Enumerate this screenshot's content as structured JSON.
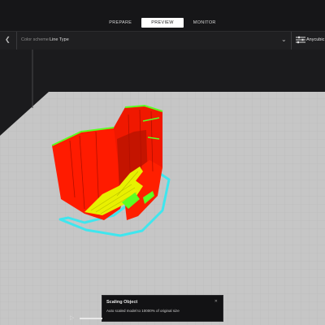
{
  "header": {
    "tabs": [
      {
        "label": "PREPARE",
        "active": false
      },
      {
        "label": "PREVIEW",
        "active": true
      },
      {
        "label": "MONITOR",
        "active": false
      }
    ]
  },
  "stage_menu": {
    "color_scheme_label": "Color scheme",
    "color_scheme_value": "Line Type",
    "printer_name": "Anycubic"
  },
  "message": {
    "title": "Scaling Object",
    "body": "Auto scaled model to 10000% of original size",
    "close_icon": "x-icon"
  },
  "colors": {
    "header_bg": "#161618",
    "active_tab_bg": "#ffffff",
    "build_plate": "#c4c4c4",
    "model_wall": "#ff1a00",
    "infill": "#e8f000",
    "support": "#66ff22",
    "skirt": "#35e0e8"
  }
}
